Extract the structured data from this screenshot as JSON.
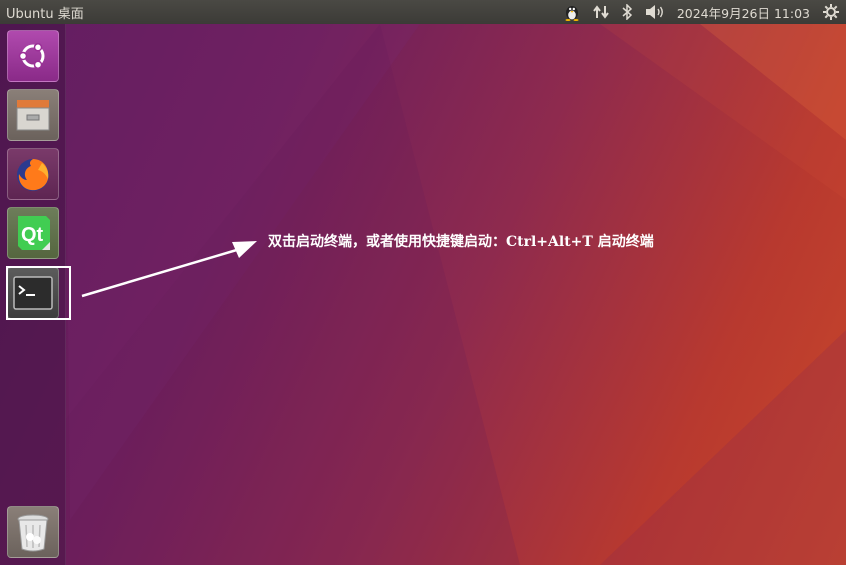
{
  "topbar": {
    "title": "Ubuntu 桌面",
    "clock": "2024年9月26日 11:03",
    "indicators": [
      "tux-icon",
      "network-updown-icon",
      "bluetooth-icon",
      "volume-icon",
      "power-gear-icon"
    ]
  },
  "launcher": {
    "items": [
      {
        "name": "ubuntu-dash-button",
        "icon": "ubuntu-logo-icon"
      },
      {
        "name": "files-button",
        "icon": "file-cabinet-icon"
      },
      {
        "name": "firefox-button",
        "icon": "firefox-icon"
      },
      {
        "name": "qt-creator-button",
        "icon": "qt-icon"
      },
      {
        "name": "terminal-button",
        "icon": "terminal-icon"
      },
      {
        "name": "trash-button",
        "icon": "trash-icon"
      }
    ]
  },
  "annotation": {
    "text": "双击启动终端，或者使用快捷键启动：Ctrl+Alt+T 启动终端"
  },
  "colors": {
    "wallpaper_start": "#5a1a5e",
    "wallpaper_end": "#c9482a",
    "topbar": "#3c3b37",
    "ubuntu_purple": "#9b2f97",
    "terminal_bg": "#2c2c2c"
  }
}
